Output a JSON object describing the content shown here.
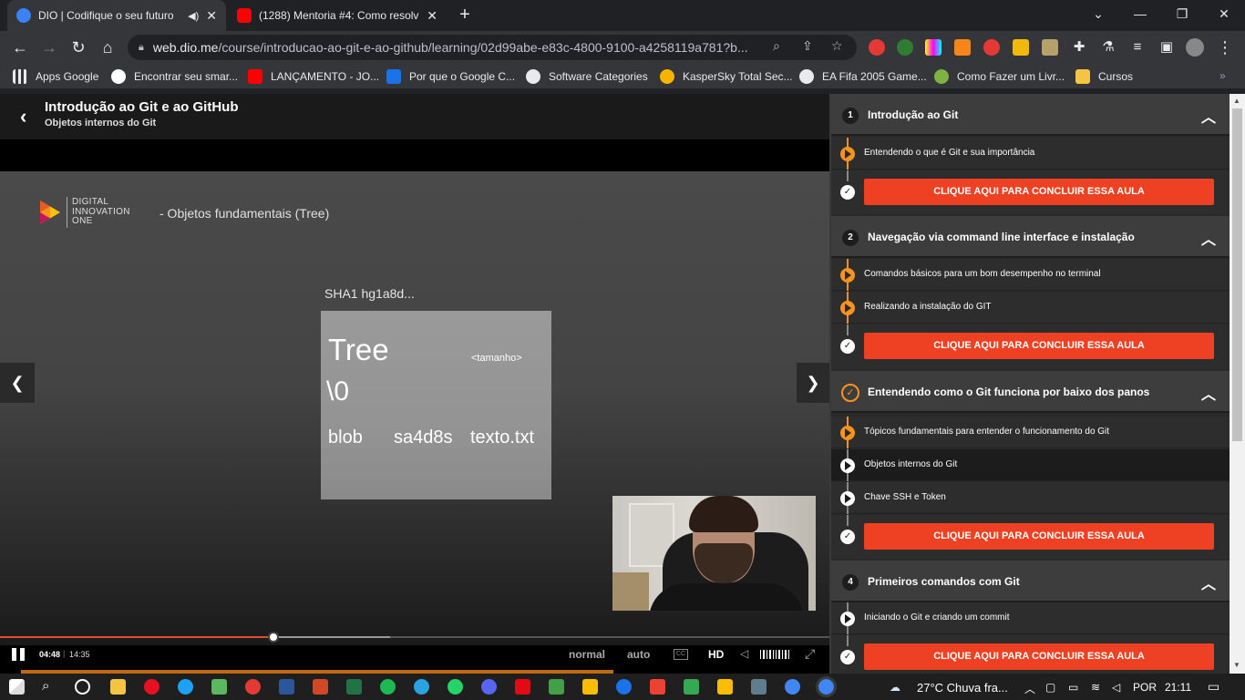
{
  "browser": {
    "tabs": [
      {
        "title": "DIO | Codifique o seu futuro",
        "icon": "dio-favicon",
        "color": "#3b82f6",
        "active": true
      },
      {
        "title": "(1288) Mentoria #4: Como resolv",
        "icon": "youtube-favicon",
        "color": "#ff0000",
        "active": false
      }
    ],
    "url_host": "web.dio.me",
    "url_path": "/course/introducao-ao-git-e-ao-github/learning/02d99abe-e83c-4800-9100-a4258119a781?b...",
    "bookmarks": [
      {
        "label": "Apps Google",
        "icon": "apps-grid-icon",
        "color": "#5f6368"
      },
      {
        "label": "Encontrar seu smar...",
        "icon": "google-icon",
        "color": "#ffffff"
      },
      {
        "label": "LANÇAMENTO - JO...",
        "icon": "youtube-icon",
        "color": "#ff0000"
      },
      {
        "label": "Por que o Google C...",
        "icon": "bookmark-blue-icon",
        "color": "#1a73e8"
      },
      {
        "label": "Software Categories",
        "icon": "globe-icon",
        "color": "#e8eaed"
      },
      {
        "label": "KasperSky Total Sec...",
        "icon": "kaspersky-icon",
        "color": "#f7b500"
      },
      {
        "label": "EA Fifa 2005 Game...",
        "icon": "globe-icon",
        "color": "#e8eaed"
      },
      {
        "label": "Como Fazer um Livr...",
        "icon": "book-icon",
        "color": "#7cb342"
      },
      {
        "label": "Cursos",
        "icon": "folder-icon",
        "color": "#f6c343"
      }
    ]
  },
  "course": {
    "title": "Introdução ao Git e ao GitHub",
    "subtitle": "Objetos internos do Git"
  },
  "slide": {
    "brand_lines": [
      "DIGITAL",
      "INNOVATION",
      "ONE"
    ],
    "heading": "- Objetos fundamentais (Tree)",
    "sha": "SHA1 hg1a8d...",
    "tree_word": "Tree",
    "size_label": "<tamanho>",
    "null_char": "\\0",
    "row": {
      "type": "blob",
      "hash": "sa4d8s",
      "name": "texto.txt"
    }
  },
  "player": {
    "current_time": "04:48",
    "duration": "14:35",
    "progress_fraction": 0.33,
    "buffered_fraction": 0.47,
    "speed_label": "normal",
    "quality_mode": "auto",
    "cc_label": "CC",
    "quality": "HD"
  },
  "sidebar": {
    "finish_label": "CLIQUE AQUI PARA CONCLUIR ESSA AULA",
    "modules": [
      {
        "num": "1",
        "title": "Introdução ao Git",
        "lessons": [
          "Entendendo o que é Git e sua importância"
        ]
      },
      {
        "num": "2",
        "title": "Navegação via command line interface e instalação",
        "lessons": [
          "Comandos básicos para um bom desempenho no terminal",
          "Realizando a instalação do GIT"
        ]
      },
      {
        "num": "",
        "title": "Entendendo como o Git funciona por baixo dos panos",
        "lessons": [
          "Tópicos fundamentais para entender o funcionamento do Git",
          "Objetos internos do Git",
          "Chave SSH e Token"
        ]
      },
      {
        "num": "4",
        "title": "Primeiros comandos com Git",
        "lessons": [
          "Iniciando o Git e criando um commit"
        ]
      }
    ]
  },
  "taskbar": {
    "weather": "27°C  Chuva fra...",
    "language": "POR",
    "time": "21:11"
  },
  "colors": {
    "accent_orange": "#f7931e",
    "finish_red": "#ee4123",
    "chrome_dark": "#202124"
  }
}
